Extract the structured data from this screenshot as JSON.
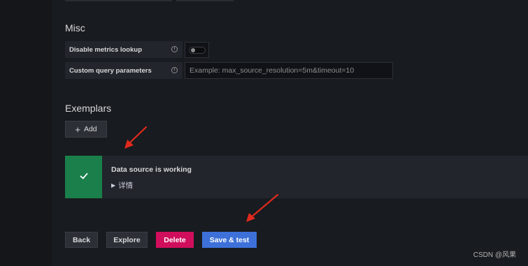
{
  "misc": {
    "title": "Misc",
    "disable_metrics_lookup": {
      "label": "Disable metrics lookup",
      "enabled": false
    },
    "custom_query_parameters": {
      "label": "Custom query parameters",
      "value": "",
      "placeholder": "Example: max_source_resolution=5m&timeout=10"
    }
  },
  "exemplars": {
    "title": "Exemplars",
    "add_label": "Add"
  },
  "alert": {
    "status": "success",
    "title": "Data source is working",
    "details_label": "详情",
    "color": "#1a7f4b"
  },
  "actions": {
    "back": "Back",
    "explore": "Explore",
    "delete": "Delete",
    "save_test": "Save & test"
  },
  "colors": {
    "delete": "#d10e5c",
    "primary": "#3d71d9",
    "annotation_arrow": "#e02a1d"
  },
  "watermark": "CSDN @风果"
}
